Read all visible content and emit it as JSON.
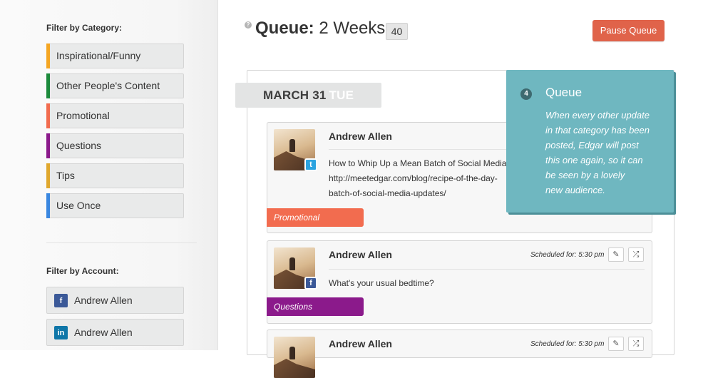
{
  "sidebar": {
    "category_heading": "Filter by Category:",
    "categories": [
      {
        "label": "Inspirational/Funny",
        "color": "#f5a623"
      },
      {
        "label": "Other People's Content",
        "color": "#1c8a3c"
      },
      {
        "label": "Promotional",
        "color": "#f26c4f"
      },
      {
        "label": "Questions",
        "color": "#8b1a8b"
      },
      {
        "label": "Tips",
        "color": "#e0a82e"
      },
      {
        "label": "Use Once",
        "color": "#3a87e0"
      }
    ],
    "account_heading": "Filter by Account:",
    "accounts": [
      {
        "label": "Andrew Allen",
        "network": "facebook",
        "icon": "facebook-icon",
        "icon_glyph": "f",
        "color": "#3b5998"
      },
      {
        "label": "Andrew Allen",
        "network": "linkedin",
        "icon": "linkedin-icon",
        "icon_glyph": "in",
        "color": "#0e76a8"
      }
    ]
  },
  "header": {
    "help_glyph": "?",
    "title_bold": "Queue:",
    "title_rest": " 2 Weeks",
    "count": "40",
    "pause_label": "Pause Queue"
  },
  "queue": {
    "date": "MARCH 31",
    "day": "TUE",
    "posts": [
      {
        "author": "Andrew Allen",
        "network": "twitter",
        "network_glyph": "t",
        "network_color": "#2ba3e0",
        "scheduled": "",
        "text_lines": [
          "How to Whip Up a Mean Batch of Social Media Updates",
          "http://meetedgar.com/blog/recipe-of-the-day-",
          "batch-of-social-media-updates/"
        ],
        "category": "Promotional",
        "category_color": "#f26c4f"
      },
      {
        "author": "Andrew Allen",
        "network": "facebook",
        "network_glyph": "f",
        "network_color": "#3b5998",
        "scheduled": "Scheduled for: 5:30 pm",
        "text_lines": [
          "What's your usual bedtime?"
        ],
        "category": "Questions",
        "category_color": "#8b1a8b"
      },
      {
        "author": "Andrew Allen",
        "network": "facebook",
        "network_glyph": "f",
        "network_color": "#3b5998",
        "scheduled": "Scheduled for: 5:30 pm",
        "text_lines": [],
        "category": "",
        "category_color": ""
      }
    ],
    "edit_glyph": "✎",
    "shuffle_glyph": "⤮"
  },
  "tooltip": {
    "number": "4",
    "title": "Queue",
    "lines": [
      "When every other update",
      "in that category has been",
      "posted, Edgar will post",
      "this one again, so it can",
      "be seen by a lovely",
      "new audience."
    ]
  }
}
